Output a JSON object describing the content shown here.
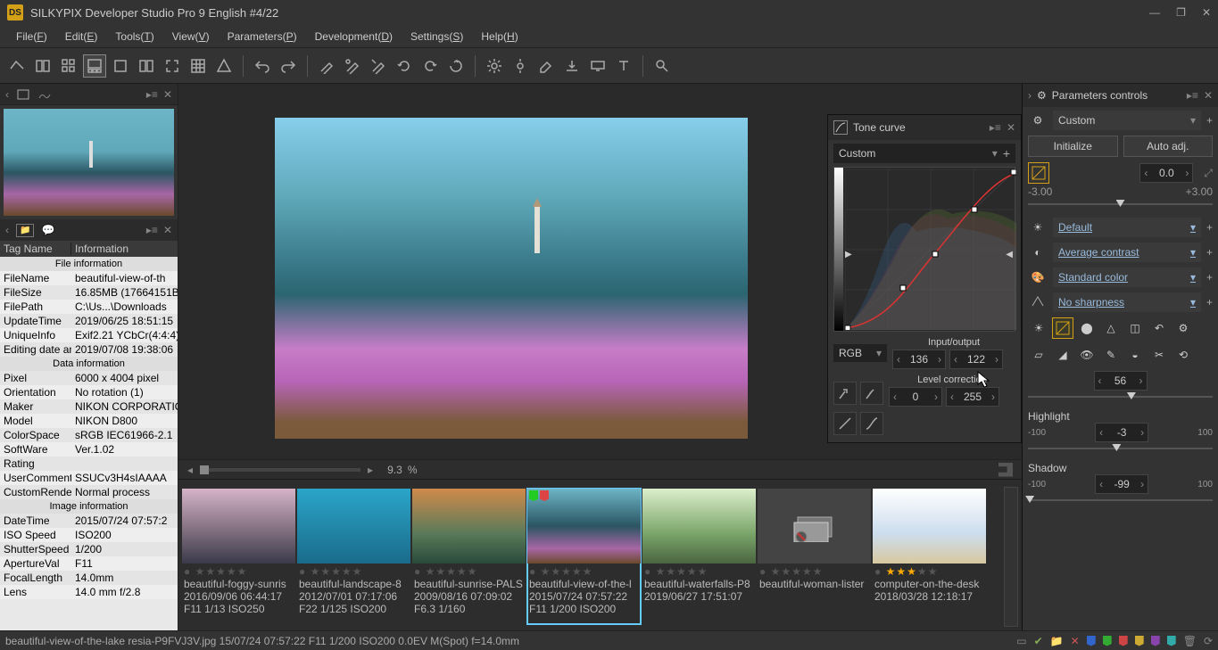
{
  "title": "SILKYPIX Developer Studio Pro 9 English   #4/22",
  "menu": [
    "File(F)",
    "Edit(E)",
    "Tools(T)",
    "View(V)",
    "Parameters(P)",
    "Development(D)",
    "Settings(S)",
    "Help(H)"
  ],
  "info_headers": {
    "tag": "Tag Name",
    "val": "Information"
  },
  "info_sections": {
    "file": "File information",
    "file_rows": [
      [
        "FileName",
        "beautiful-view-of-th"
      ],
      [
        "FileSize",
        "16.85MB (17664151B"
      ],
      [
        "FilePath",
        "C:\\Us...\\Downloads"
      ],
      [
        "UpdateTime",
        "2019/06/25 18:51:15"
      ],
      [
        "UniqueInfo",
        "Exif2.21 YCbCr(4:4:4)"
      ],
      [
        "Editing date an",
        "2019/07/08 19:38:06"
      ]
    ],
    "data": "Data information",
    "data_rows": [
      [
        "Pixel",
        "6000 x 4004 pixel"
      ],
      [
        "Orientation",
        "No rotation (1)"
      ],
      [
        "Maker",
        "NIKON CORPORATIO"
      ],
      [
        "Model",
        "NIKON D800"
      ],
      [
        "ColorSpace",
        "sRGB IEC61966-2.1"
      ],
      [
        "SoftWare",
        "Ver.1.02"
      ],
      [
        "Rating",
        ""
      ],
      [
        "UserComment",
        "SSUCv3H4sIAAAA"
      ],
      [
        "CustomRender",
        "Normal process"
      ]
    ],
    "image": "Image information",
    "image_rows": [
      [
        "DateTime",
        "2015/07/24 07:57:2"
      ],
      [
        "ISO Speed",
        "ISO200"
      ],
      [
        "ShutterSpeed",
        "1/200"
      ],
      [
        "ApertureVal",
        "F11"
      ],
      [
        "FocalLength",
        "14.0mm"
      ],
      [
        "Lens",
        "14.0 mm f/2.8"
      ]
    ]
  },
  "zoom": "9.3",
  "zoom_unit": "%",
  "thumbs": [
    {
      "cls": "t1",
      "name": "beautiful-foggy-sunris",
      "l2": "2016/09/06 06:44:17",
      "l3": "F11 1/13 ISO250",
      "stars": 0
    },
    {
      "cls": "t2",
      "name": "beautiful-landscape-8",
      "l2": "2012/07/01 07:17:06",
      "l3": "F22 1/125 ISO200",
      "stars": 0
    },
    {
      "cls": "t3",
      "name": "beautiful-sunrise-PALS",
      "l2": "2009/08/16 07:09:02",
      "l3": "F6.3 1/160",
      "stars": 0
    },
    {
      "cls": "t4",
      "name": "beautiful-view-of-the-l",
      "l2": "2015/07/24 07:57:22",
      "l3": "F11 1/200 ISO200",
      "stars": 0,
      "sel": true,
      "tags": [
        "g",
        "r"
      ]
    },
    {
      "cls": "t5",
      "name": "beautiful-waterfalls-P8",
      "l2": "2019/06/27 17:51:07",
      "l3": "",
      "stars": 0
    },
    {
      "cls": "t6",
      "name": "beautiful-woman-lister",
      "l2": "",
      "l3": "",
      "stars": 0
    },
    {
      "cls": "t7",
      "name": "computer-on-the-desk",
      "l2": "2018/03/28 12:18:17",
      "l3": "",
      "stars": 3
    }
  ],
  "tone": {
    "title": "Tone curve",
    "preset": "Custom",
    "channel": "RGB",
    "io_label": "Input/output",
    "in": "136",
    "out": "122",
    "lc_label": "Level correction",
    "l1": "0",
    "l2": "255"
  },
  "params": {
    "title": "Parameters controls",
    "preset": "Custom",
    "init": "Initialize",
    "auto": "Auto adj.",
    "ev": "0.0",
    "ev_lo": "-3.00",
    "ev_hi": "+3.00",
    "wb": "Default",
    "tone_preset": "Average contrast",
    "color": "Standard color",
    "sharp": "No sharpness",
    "mid": "56",
    "hl_label": "Highlight",
    "hl_lo": "-100",
    "hl_v": "-3",
    "hl_hi": "100",
    "sh_label": "Shadow",
    "sh_lo": "-100",
    "sh_v": "-99",
    "sh_hi": "100"
  },
  "status": "beautiful-view-of-the-lake resia-P9FVJ3V.jpg 15/07/24 07:57:22 F11 1/200 ISO200  0.0EV M(Spot) f=14.0mm"
}
